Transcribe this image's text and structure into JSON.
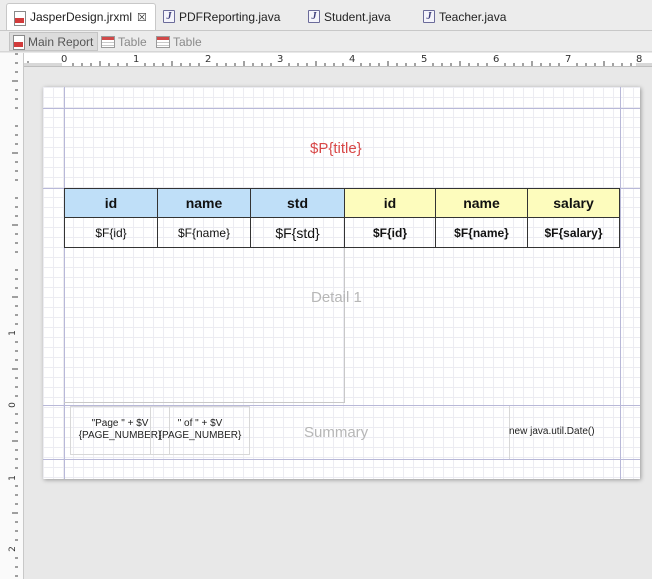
{
  "editor_tabs": [
    {
      "label": "JasperDesign.jrxml",
      "icon": "jrxml-file-icon",
      "active": true
    },
    {
      "label": "PDFReporting.java",
      "icon": "java-file-icon"
    },
    {
      "label": "Student.java",
      "icon": "java-file-icon"
    },
    {
      "label": "Teacher.java",
      "icon": "java-file-icon"
    }
  ],
  "sub_tabs": [
    {
      "label": "Main Report",
      "icon": "report-icon",
      "active": true
    },
    {
      "label": "Table",
      "icon": "table-icon"
    },
    {
      "label": "Table",
      "icon": "table-icon"
    }
  ],
  "hruler": [
    "0",
    "1",
    "2",
    "3",
    "4",
    "5",
    "6",
    "7",
    "8"
  ],
  "vruler": [
    "1",
    "0",
    "1",
    "2"
  ],
  "report": {
    "title_field": "$P{title}",
    "table": {
      "headers": [
        "id",
        "name",
        "std",
        "id",
        "name",
        "salary"
      ],
      "cells": [
        "$F{id}",
        "$F{name}",
        "$F{std}",
        "$F{id}",
        "$F{name}",
        "$F{salary}"
      ]
    },
    "detail_label": "Detail 1",
    "summary_label": "Summary",
    "page_number_field": "\"Page \" + $V\n{PAGE_NUMBER}",
    "page_total_field": "\" of \" + $V\n{PAGE_NUMBER}",
    "date_field": "new java.util.Date()"
  },
  "colors": {
    "title": "#d84848",
    "header_blue": "#bfdff8",
    "header_yellow": "#fdfcbd"
  }
}
